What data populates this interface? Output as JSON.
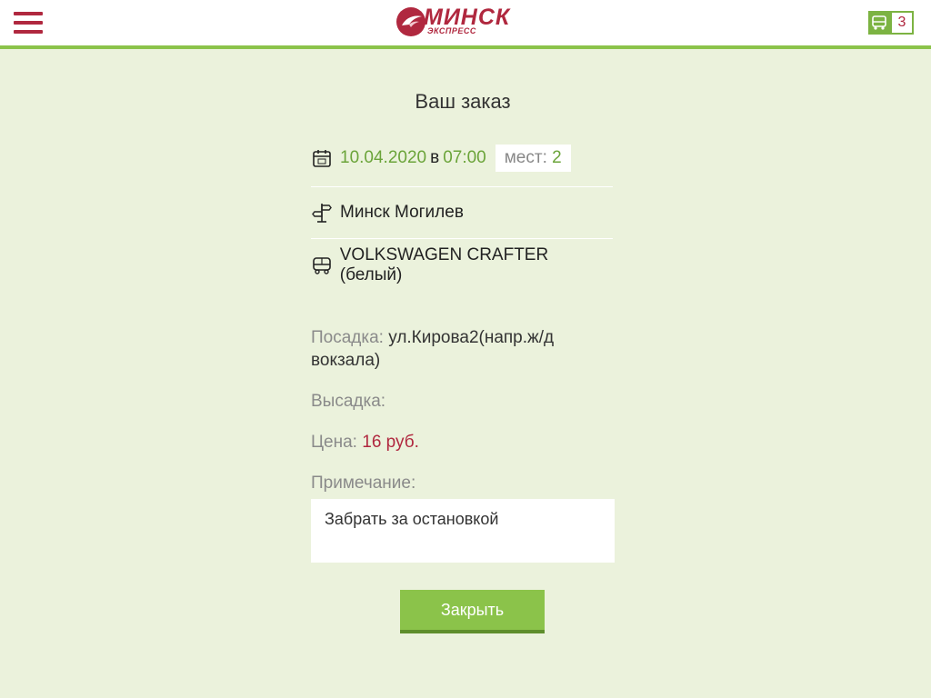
{
  "header": {
    "logo_title": "МИНСК",
    "logo_subtitle": "ЭКСПРЕСС",
    "cart_count": "3",
    "icons": {
      "menu": "hamburger-icon",
      "cart": "bus-icon"
    },
    "colors": {
      "brand": "#b0283f",
      "accent": "#8bc34a",
      "background": "#ebf2dc"
    }
  },
  "order": {
    "title": "Ваш заказ",
    "date": "10.04.2020",
    "at": "в",
    "time": "07:00",
    "seats_label": "мест:",
    "seats_value": "2",
    "route": "Минск Могилев",
    "vehicle": "VOLKSWAGEN CRAFTER (белый)",
    "boarding_label": "Посадка:",
    "boarding_value": "ул.Кирова2(напр.ж/д вокзала)",
    "dropoff_label": "Высадка:",
    "price_label": "Цена:",
    "price_value": "16 руб.",
    "note_label": "Примечание:",
    "note_value": "Забрать за остановкой",
    "close_label": "Закрыть"
  }
}
